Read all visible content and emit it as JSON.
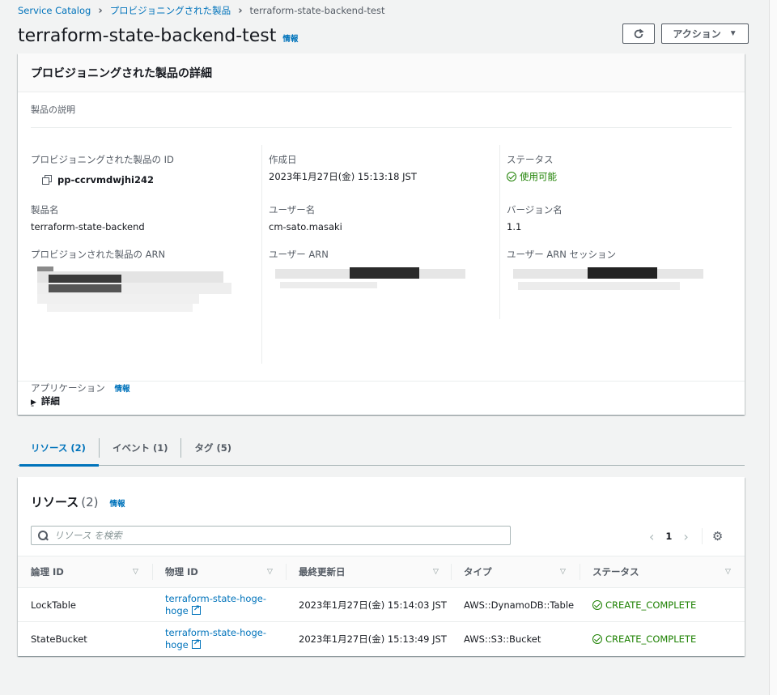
{
  "breadcrumb": {
    "items": [
      "Service Catalog",
      "プロビジョニングされた製品",
      "terraform-state-backend-test"
    ]
  },
  "page": {
    "title": "terraform-state-backend-test",
    "info": "情報",
    "action_label": "アクション"
  },
  "details": {
    "header": "プロビジョニングされた製品の詳細",
    "description_label": "製品の説明",
    "fields": {
      "provisioned_id_label": "プロビジョニングされた製品の ID",
      "provisioned_id_value": "pp-ccrvmdwjhi242",
      "product_name_label": "製品名",
      "product_name_value": "terraform-state-backend",
      "provisioned_arn_label": "プロビジョンされた製品の ARN",
      "application_label": "アプリケーション",
      "application_info": "情報",
      "application_value": "-",
      "created_label": "作成日",
      "created_value": "2023年1月27日(金) 15:13:18 JST",
      "user_name_label": "ユーザー名",
      "user_name_value": "cm-sato.masaki",
      "user_arn_label": "ユーザー ARN",
      "status_label": "ステータス",
      "status_value": "使用可能",
      "version_label": "バージョン名",
      "version_value": "1.1",
      "user_arn_session_label": "ユーザー ARN セッション"
    },
    "more_toggle": "詳細"
  },
  "tabs": [
    {
      "label": "リソース (2)",
      "active": true
    },
    {
      "label": "イベント (1)",
      "active": false
    },
    {
      "label": "タグ (5)",
      "active": false
    }
  ],
  "resources": {
    "title": "リソース",
    "count": "(2)",
    "info": "情報",
    "search_placeholder": "リソース を検索",
    "page": "1",
    "columns": [
      "論理 ID",
      "物理 ID",
      "最終更新日",
      "タイプ",
      "ステータス"
    ],
    "rows": [
      {
        "logical_id": "LockTable",
        "physical_id": "terraform-state-hoge-hoge",
        "updated": "2023年1月27日(金) 15:14:03 JST",
        "type": "AWS::DynamoDB::Table",
        "status": "CREATE_COMPLETE"
      },
      {
        "logical_id": "StateBucket",
        "physical_id": "terraform-state-hoge-hoge",
        "updated": "2023年1月27日(金) 15:13:49 JST",
        "type": "AWS::S3::Bucket",
        "status": "CREATE_COMPLETE"
      }
    ]
  },
  "colors": {
    "link": "#0073bb",
    "success": "#1d8102",
    "text": "#16191f",
    "muted": "#545b64",
    "background": "#f2f3f3"
  },
  "icons": [
    "chevron-right-icon",
    "refresh-icon",
    "caret-down-icon",
    "copy-icon",
    "check-circle-icon",
    "caret-right-icon",
    "search-icon",
    "chevron-left-icon",
    "settings-icon",
    "sort-icon",
    "external-link-icon"
  ]
}
